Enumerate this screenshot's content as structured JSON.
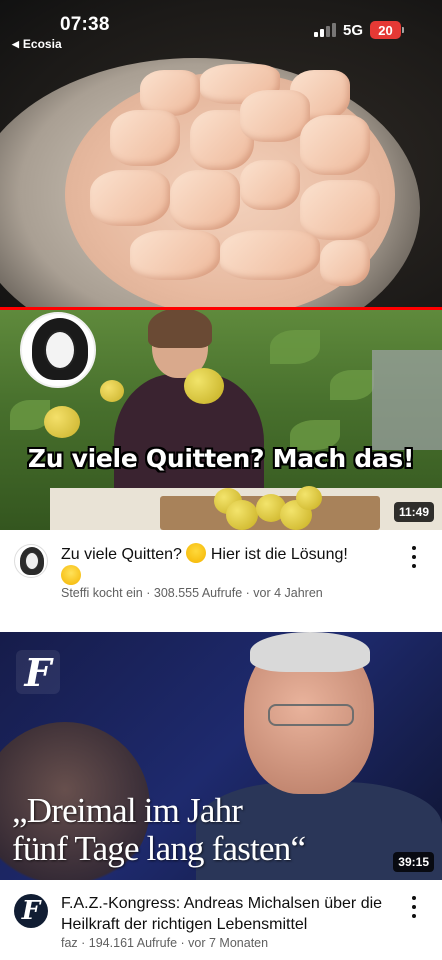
{
  "status_bar": {
    "time": "07:38",
    "back_app": "Ecosia",
    "network": "5G",
    "battery": "20"
  },
  "videos": [
    {
      "thumbnail_title": "Zu viele Quitten?  Mach das!",
      "duration": "11:49",
      "title": "Zu viele Quitten? 😱 Hier ist die Lösung! 😃",
      "title_text": "Zu viele Quitten?",
      "title_text_2": "Hier ist die Lösung!",
      "channel": "Steffi kocht ein",
      "meta": "Steffi kocht ein · 308.555 Aufrufe · vor 4 Jahren"
    },
    {
      "thumbnail_title_line1": "„Dreimal im Jahr",
      "thumbnail_title_line2": "fünf Tage lang fasten“",
      "duration": "39:15",
      "title": "F.A.Z.-Kongress: Andreas Michalsen über die Heilkraft der richtigen Lebensmittel",
      "channel": "faz",
      "meta": "faz · 194.161 Aufrufe · vor 7 Monaten",
      "logo_letter": "F"
    }
  ],
  "colors": {
    "progress": "#ff0000",
    "battery": "#e53935",
    "meta_text": "#606060"
  }
}
